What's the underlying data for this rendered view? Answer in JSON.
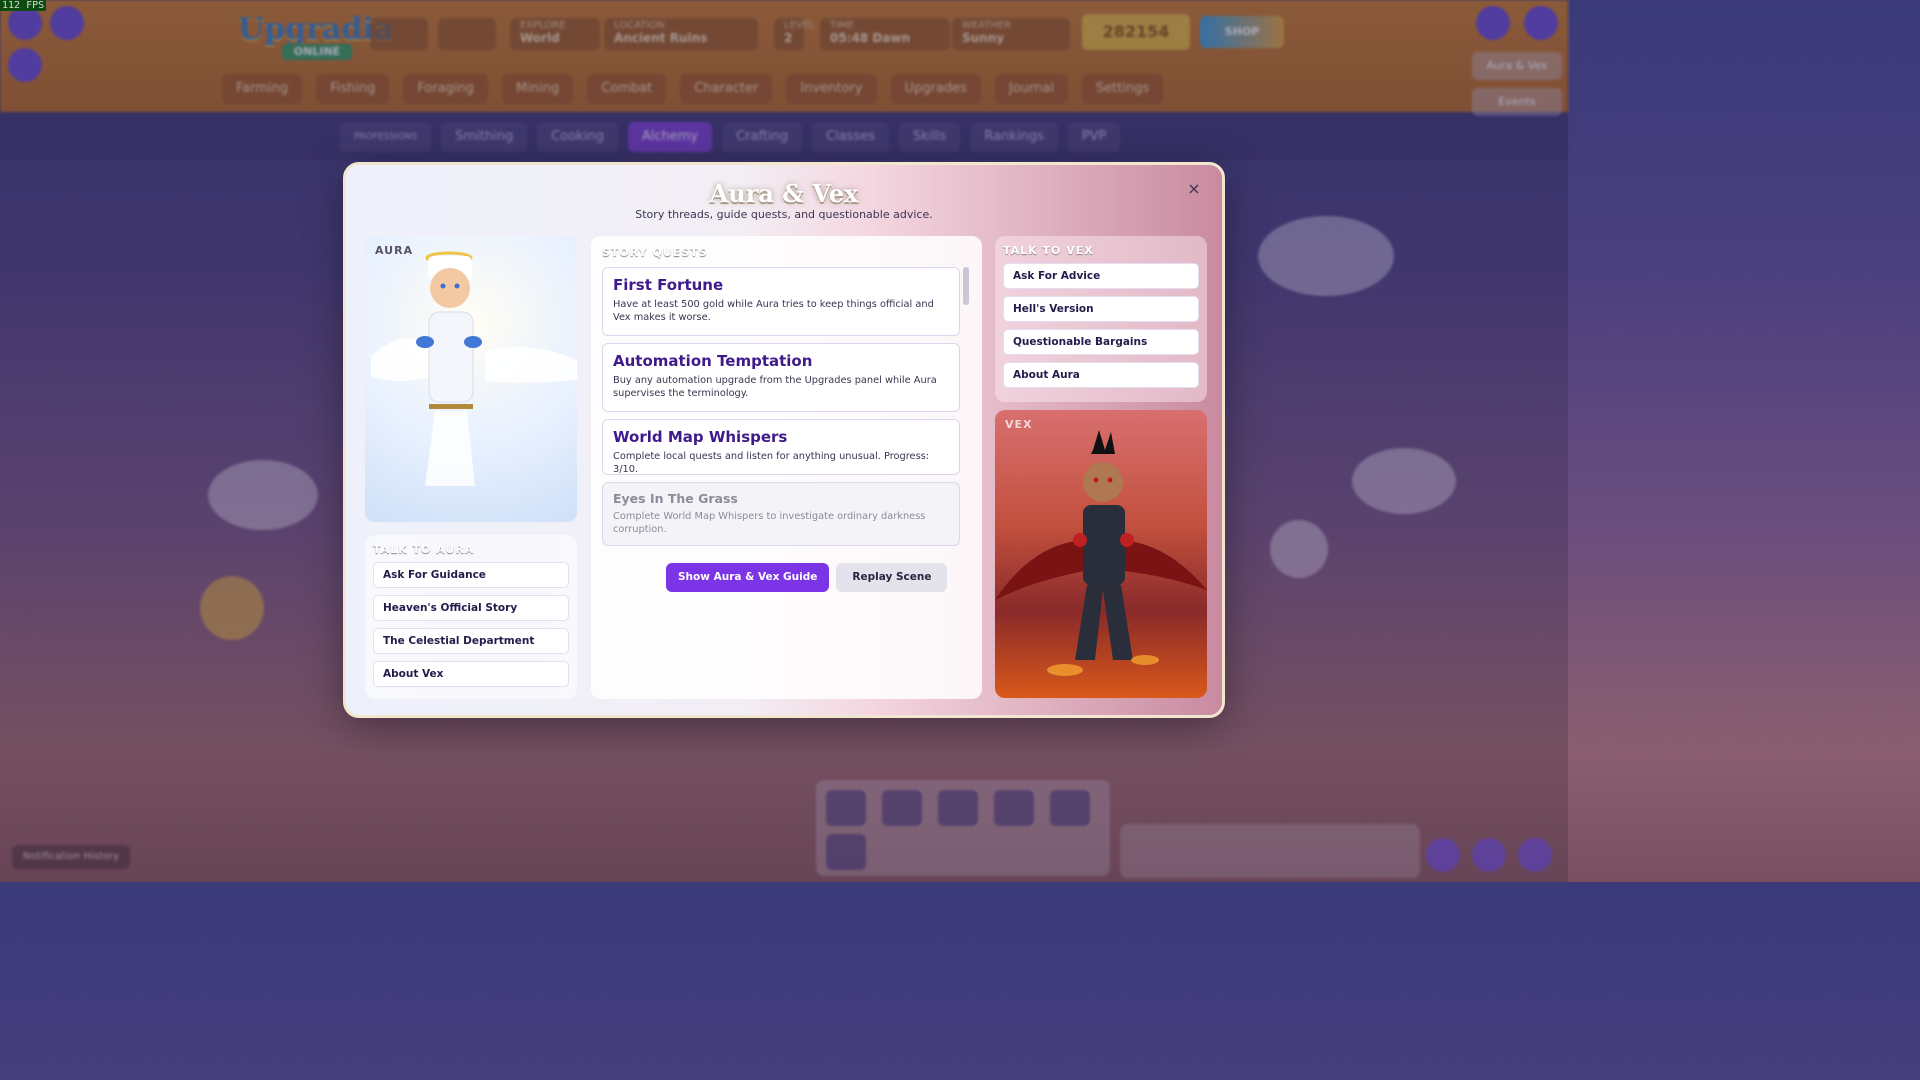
{
  "fps": "112 FPS",
  "game": {
    "logo_line1": "Upgradia",
    "logo_line2": "ONLINE"
  },
  "hud": {
    "explore_label": "EXPLORE",
    "explore_value": "World",
    "location_label": "LOCATION",
    "location_value": "Ancient Ruins",
    "level_label": "LEVEL",
    "level_value": "2",
    "time_label": "TIME",
    "time_value": "05:48 Dawn",
    "weather_label": "WEATHER",
    "weather_value": "Sunny",
    "gold": "282154",
    "shop_label": "SHOP"
  },
  "nav_primary": [
    "Farming",
    "Fishing",
    "Foraging",
    "Mining",
    "Combat",
    "Character",
    "Inventory",
    "Upgrades",
    "Journal",
    "Settings"
  ],
  "nav_secondary": [
    "PROFESSIONS",
    "Smithing",
    "Cooking",
    "Alchemy",
    "Crafting",
    "Classes",
    "Skills",
    "Rankings",
    "PVP"
  ],
  "right_buttons": [
    "Aura & Vex",
    "Events"
  ],
  "notification_history": "Notification History",
  "modal": {
    "title": "Aura & Vex",
    "subtitle": "Story threads, guide quests, and questionable advice.",
    "close_glyph": "×",
    "aura_label": "AURA",
    "vex_label": "VEX",
    "talk_aura": {
      "title": "TALK TO AURA",
      "buttons": [
        "Ask For Guidance",
        "Heaven's Official Story",
        "The Celestial Department",
        "About Vex"
      ]
    },
    "talk_vex": {
      "title": "TALK TO VEX",
      "buttons": [
        "Ask For Advice",
        "Hell's Version",
        "Questionable Bargains",
        "About Aura"
      ]
    },
    "story_quests": {
      "title": "STORY QUESTS",
      "quests": [
        {
          "name": "First Fortune",
          "desc": "Have at least 500 gold while Aura tries to keep things official and Vex makes it worse."
        },
        {
          "name": "Automation Temptation",
          "desc": "Buy any automation upgrade from the Upgrades panel while Aura supervises the terminology."
        },
        {
          "name": "World Map Whispers",
          "desc": "Complete local quests and listen for anything unusual. Progress: 3/10."
        },
        {
          "name": "Eyes In The Grass",
          "desc": "Complete World Map Whispers to investigate ordinary darkness corruption."
        }
      ]
    },
    "show_guide_button": "Show Aura & Vex Guide",
    "replay_button": "Replay Scene"
  },
  "colors": {
    "accent": "#7b35e6",
    "quest_title": "#3e1a8a",
    "gold": "#e6b53a"
  }
}
